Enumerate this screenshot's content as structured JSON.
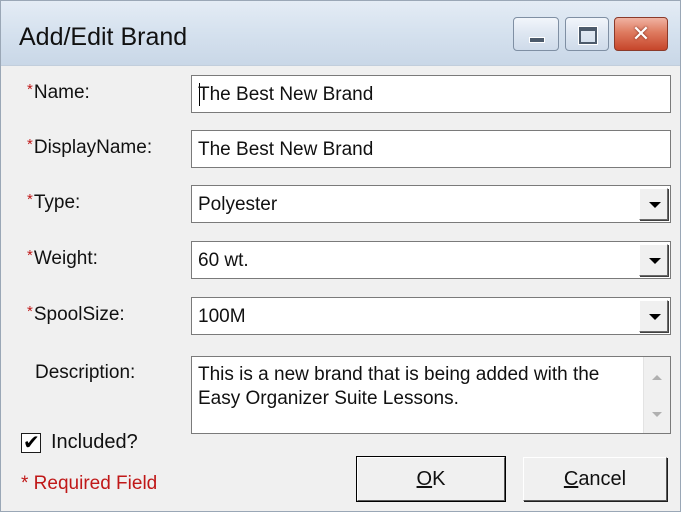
{
  "window": {
    "title": "Add/Edit Brand",
    "controls": {
      "minimize": "minimize-icon",
      "maximize": "maximize-icon",
      "close": "close-icon"
    }
  },
  "form": {
    "required_marker": "*",
    "name": {
      "label": "Name:",
      "value": "The Best New Brand"
    },
    "display_name": {
      "label": "DisplayName:",
      "value": "The Best New Brand"
    },
    "type": {
      "label": "Type:",
      "value": "Polyester"
    },
    "weight": {
      "label": "Weight:",
      "value": "60 wt."
    },
    "spool_size": {
      "label": "SpoolSize:",
      "value": "100M"
    },
    "description": {
      "label": "Description:",
      "value": "This is a new brand that is being added with the Easy Organizer Suite Lessons."
    },
    "included": {
      "label": "Included?",
      "checked": true,
      "mark": "✔"
    },
    "required_note": "* Required Field"
  },
  "buttons": {
    "ok": {
      "mnemonic": "O",
      "rest": "K"
    },
    "cancel": {
      "mnemonic": "C",
      "rest": "ancel"
    }
  },
  "colors": {
    "required": "#c01818",
    "title_bar": "#d5e1ee",
    "close_button": "#c6452a"
  }
}
